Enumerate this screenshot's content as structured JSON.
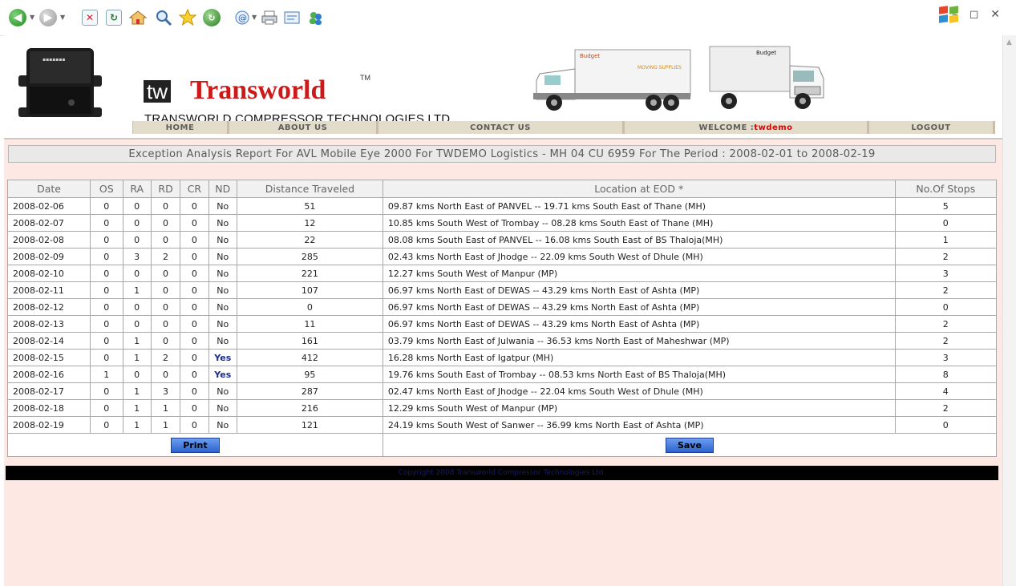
{
  "browser": {
    "toolbar_icons": [
      "back-icon",
      "forward-icon",
      "stop-icon",
      "refresh-icon",
      "home-icon",
      "search-icon",
      "favorites-icon",
      "history-icon",
      "mail-icon",
      "print-icon",
      "edit-icon",
      "messenger-icon"
    ]
  },
  "header": {
    "logo_mark": "tw",
    "brand": "Transworld",
    "tm": "TM",
    "tagline": "TRANSWORLD COMPRESSOR TECHNOLOGIES LTD.",
    "truck1_text": "Budget",
    "truck1_sub": "MOVING SUPPLIES",
    "truck2_text": "Budget",
    "nav": {
      "home": "HOME",
      "about": "ABOUT US",
      "contact": "CONTACT US",
      "welcome_label": "WELCOME :",
      "welcome_user": "twdemo",
      "logout": "LOGOUT"
    }
  },
  "report_title": "Exception Analysis Report For AVL Mobile Eye 2000 For TWDEMO Logistics - MH 04 CU 6959 For The Period : 2008-02-01 to 2008-02-19",
  "table": {
    "columns": [
      "Date",
      "OS",
      "RA",
      "RD",
      "CR",
      "ND",
      "Distance Traveled",
      "Location at EOD *",
      "No.Of Stops"
    ],
    "rows": [
      [
        "2008-02-06",
        "0",
        "0",
        "0",
        "0",
        "No",
        "51",
        "09.87 kms North East of PANVEL -- 19.71 kms South East of Thane (MH)",
        "5"
      ],
      [
        "2008-02-07",
        "0",
        "0",
        "0",
        "0",
        "No",
        "12",
        "10.85 kms South West of Trombay -- 08.28 kms South East of Thane (MH)",
        "0"
      ],
      [
        "2008-02-08",
        "0",
        "0",
        "0",
        "0",
        "No",
        "22",
        "08.08 kms South East of PANVEL -- 16.08 kms South East of BS Thaloja(MH)",
        "1"
      ],
      [
        "2008-02-09",
        "0",
        "3",
        "2",
        "0",
        "No",
        "285",
        "02.43 kms North East of Jhodge -- 22.09 kms South West of Dhule (MH)",
        "2"
      ],
      [
        "2008-02-10",
        "0",
        "0",
        "0",
        "0",
        "No",
        "221",
        "12.27 kms South West of Manpur (MP)",
        "3"
      ],
      [
        "2008-02-11",
        "0",
        "1",
        "0",
        "0",
        "No",
        "107",
        "06.97 kms North East of DEWAS -- 43.29 kms North East of Ashta (MP)",
        "2"
      ],
      [
        "2008-02-12",
        "0",
        "0",
        "0",
        "0",
        "No",
        "0",
        "06.97 kms North East of DEWAS -- 43.29 kms North East of Ashta (MP)",
        "0"
      ],
      [
        "2008-02-13",
        "0",
        "0",
        "0",
        "0",
        "No",
        "11",
        "06.97 kms North East of DEWAS -- 43.29 kms North East of Ashta (MP)",
        "2"
      ],
      [
        "2008-02-14",
        "0",
        "1",
        "0",
        "0",
        "No",
        "161",
        "03.79 kms North East of Julwania -- 36.53 kms North East of Maheshwar (MP)",
        "2"
      ],
      [
        "2008-02-15",
        "0",
        "1",
        "2",
        "0",
        "Yes",
        "412",
        "16.28 kms North East of Igatpur (MH)",
        "3"
      ],
      [
        "2008-02-16",
        "1",
        "0",
        "0",
        "0",
        "Yes",
        "95",
        "19.76 kms South East of Trombay -- 08.53 kms North East of BS Thaloja(MH)",
        "8"
      ],
      [
        "2008-02-17",
        "0",
        "1",
        "3",
        "0",
        "No",
        "287",
        "02.47 kms North East of Jhodge -- 22.04 kms South West of Dhule (MH)",
        "4"
      ],
      [
        "2008-02-18",
        "0",
        "1",
        "1",
        "0",
        "No",
        "216",
        "12.29 kms South West of Manpur (MP)",
        "2"
      ],
      [
        "2008-02-19",
        "0",
        "1",
        "1",
        "0",
        "No",
        "121",
        "24.19 kms South West of Sanwer -- 36.99 kms North East of Ashta (MP)",
        "0"
      ]
    ]
  },
  "buttons": {
    "print": "Print",
    "save": "Save"
  },
  "footer": "Copyright 2008 Transworld Compressor Technologies Ltd.",
  "colors": {
    "brand_red": "#cc1a1a",
    "page_bg": "#fde8e4",
    "button_blue": "#2b62cf",
    "yes_text": "#1c2c8c"
  }
}
